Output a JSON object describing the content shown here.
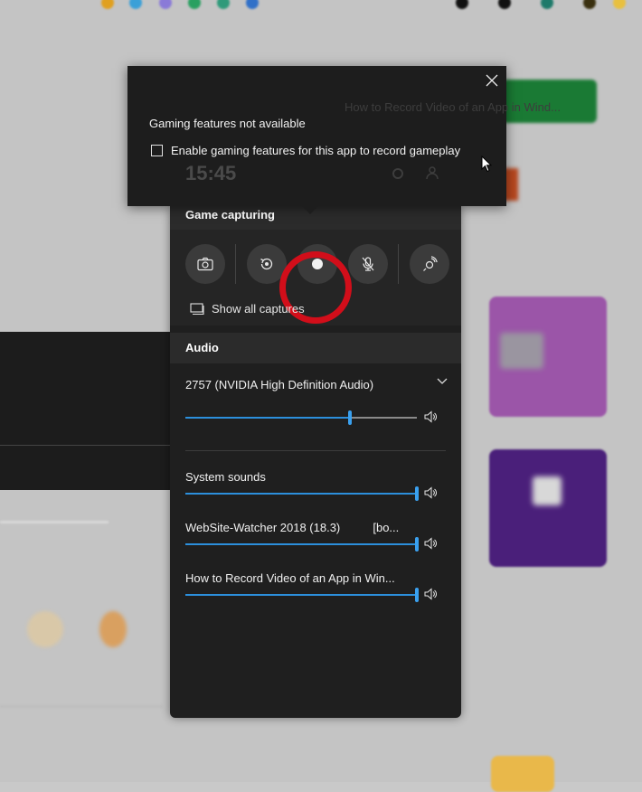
{
  "popup": {
    "title": "Gaming features not available",
    "checkbox_label": "Enable gaming features for this app to record gameplay",
    "checkbox_checked": false,
    "background_clock": "15:45",
    "background_heading": "How to Record Video of an App in Wind..."
  },
  "capture": {
    "header": "Game capturing",
    "buttons": [
      {
        "name": "screenshot",
        "icon": "camera-icon"
      },
      {
        "name": "record-last",
        "icon": "replay-icon"
      },
      {
        "name": "record",
        "icon": "record-dot-icon"
      },
      {
        "name": "mic",
        "icon": "mic-off-icon"
      },
      {
        "name": "broadcast",
        "icon": "broadcast-icon"
      }
    ],
    "show_all_label": "Show all captures"
  },
  "audio": {
    "header": "Audio",
    "device_name": "2757 (NVIDIA High Definition Audio)",
    "device_volume": 0.71,
    "apps": [
      {
        "label": "System sounds",
        "volume": 1.0
      },
      {
        "label": "WebSite-Watcher 2018 (18.3)          [bo...",
        "volume": 1.0
      },
      {
        "label": "How to Record Video of an App in Win...",
        "volume": 1.0
      }
    ]
  },
  "colors": {
    "accent": "#2c8fdc",
    "highlight_ring": "#d20e1a",
    "panel": "#1f1f1f"
  }
}
